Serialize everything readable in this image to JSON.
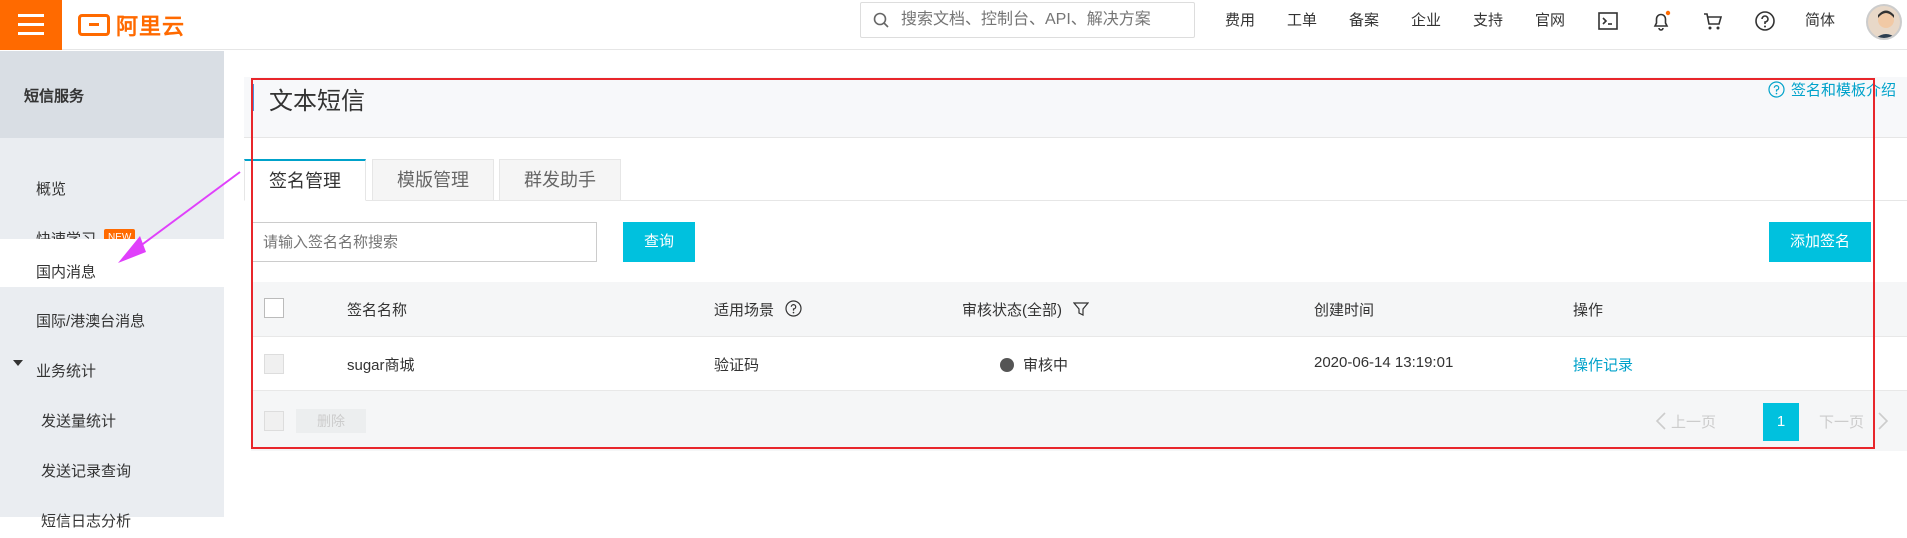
{
  "topbar": {
    "logo_text": "阿里云",
    "search_placeholder": "搜索文档、控制台、API、解决方案",
    "nav": [
      "费用",
      "工单",
      "备案",
      "企业",
      "支持",
      "官网"
    ],
    "lang": "简体",
    "icons": [
      "terminal-icon",
      "bell-icon",
      "cart-icon",
      "help-icon"
    ],
    "accent": "#ff6a00"
  },
  "sidebar": {
    "title": "短信服务",
    "items": [
      {
        "label": "概览"
      },
      {
        "label": "快速学习",
        "badge": "NEW"
      },
      {
        "label": "国内消息",
        "active": true
      },
      {
        "label": "国际/港澳台消息"
      },
      {
        "label": "业务统计",
        "expanded": true
      },
      {
        "label": "发送量统计"
      },
      {
        "label": "发送记录查询"
      },
      {
        "label": "短信日志分析"
      }
    ]
  },
  "main": {
    "title": "文本短信",
    "help_link": "签名和模板介绍",
    "tabs": [
      "签名管理",
      "模版管理",
      "群发助手"
    ],
    "search_placeholder": "请输入签名名称搜索",
    "query_label": "查询",
    "add_label": "添加签名",
    "table": {
      "columns": [
        "签名名称",
        "适用场景",
        "审核状态(全部)",
        "创建时间",
        "操作"
      ],
      "rows": [
        {
          "name": "sugar商城",
          "scene": "验证码",
          "status": "审核中",
          "created": "2020-06-14 13:19:01",
          "action": "操作记录"
        }
      ]
    },
    "footer": {
      "delete_label": "删除",
      "prev_label": "上一页",
      "page": "1",
      "next_label": "下一页"
    },
    "button_color": "#00c1de",
    "link_color": "#00a2ca"
  }
}
